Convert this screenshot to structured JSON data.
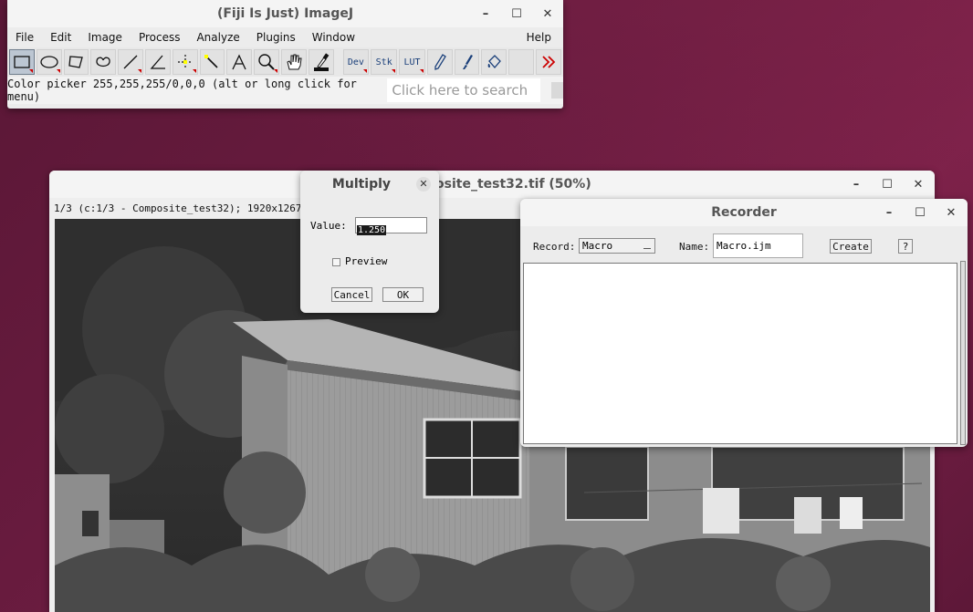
{
  "imagej": {
    "title": "(Fiji Is Just) ImageJ",
    "menus": [
      "File",
      "Edit",
      "Image",
      "Process",
      "Analyze",
      "Plugins",
      "Window"
    ],
    "help_menu": "Help",
    "tools_text": {
      "dev": "Dev",
      "stk": "Stk",
      "lut": "LUT"
    },
    "status": "Color picker 255,255,255/0,0,0 (alt or long click for menu)",
    "search_placeholder": "Click here to search",
    "window_controls": {
      "minimize": "–",
      "maximize": "☐",
      "close": "✕"
    }
  },
  "image_window": {
    "title": "osite_test32.tif (50%)",
    "info": "1/3 (c:1/3 - Composite_test32); 1920x1267 pix"
  },
  "multiply_dialog": {
    "title": "Multiply",
    "value_label": "Value:",
    "value": "1.250",
    "preview_label": "Preview",
    "cancel_label": "Cancel",
    "ok_label": "OK",
    "close": "✕"
  },
  "recorder": {
    "title": "Recorder",
    "record_label": "Record:",
    "record_value": "Macro",
    "name_label": "Name:",
    "name_value": "Macro.ijm",
    "create_label": "Create",
    "help_label": "?"
  }
}
